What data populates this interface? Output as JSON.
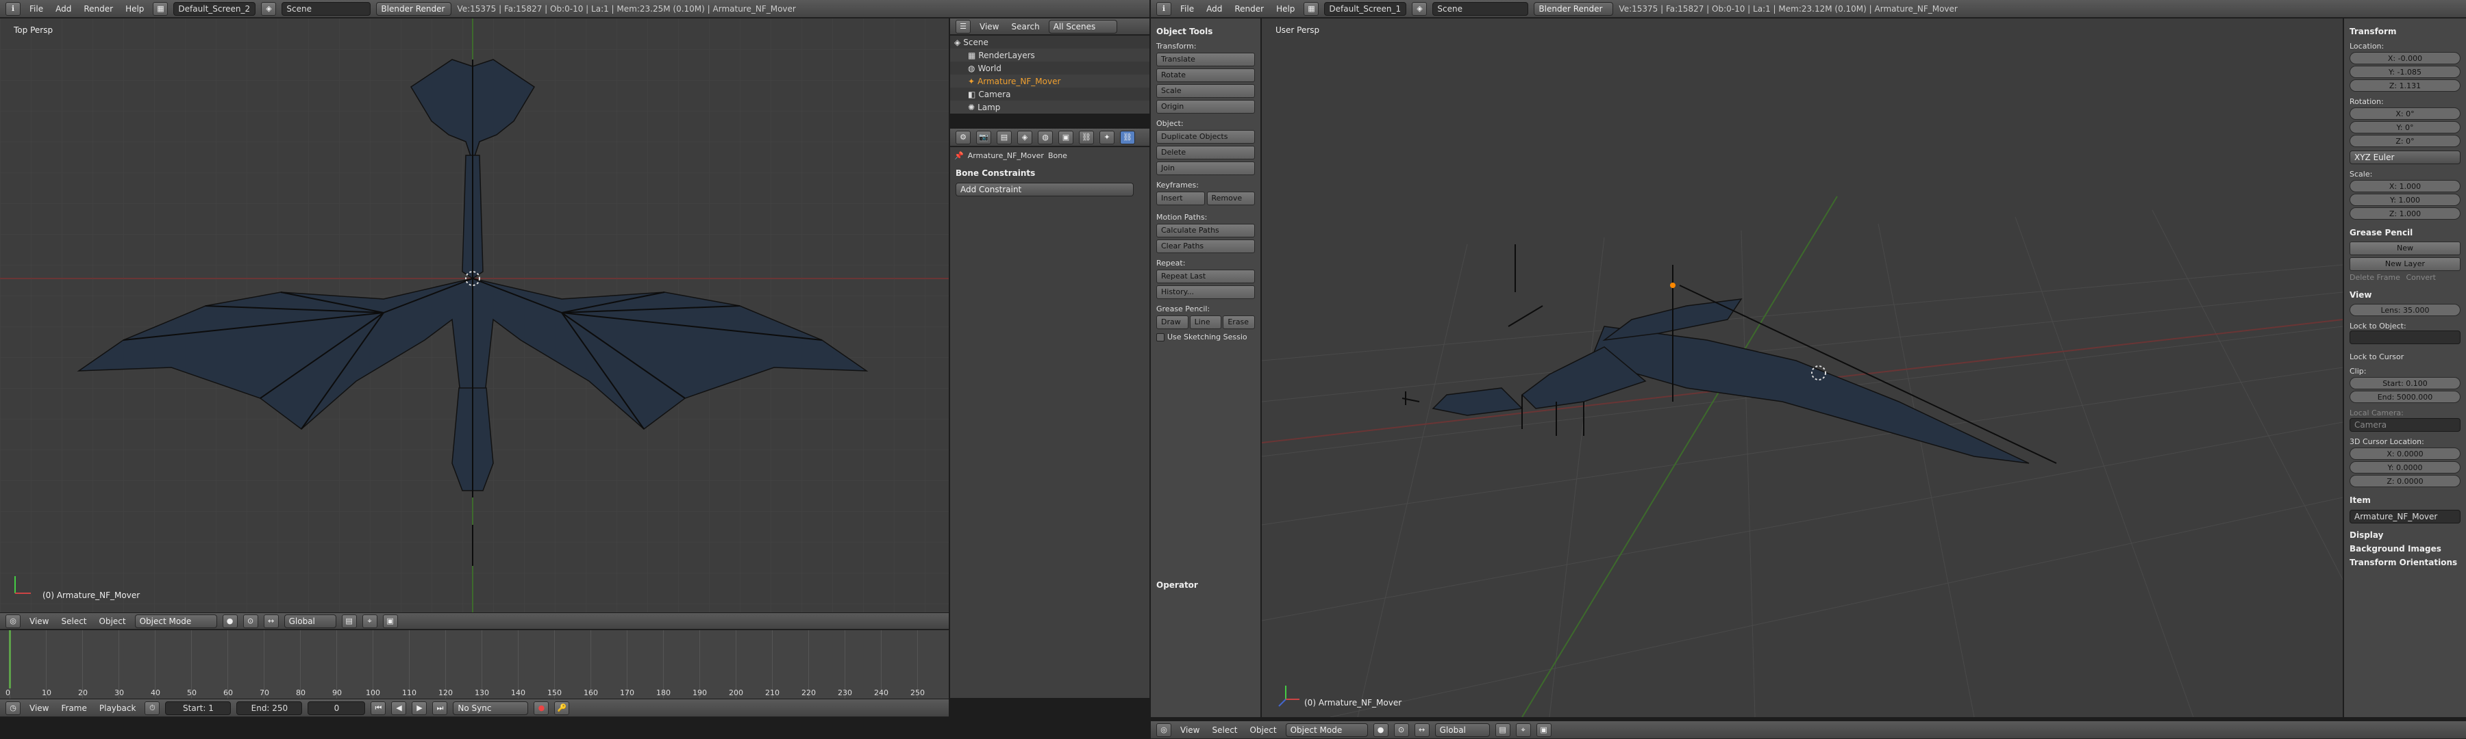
{
  "left": {
    "header": {
      "menus": [
        "File",
        "Add",
        "Render",
        "Help"
      ],
      "screen": "Default_Screen_2",
      "scene": "Scene",
      "engine": "Blender Render",
      "stats": "Ve:15375 | Fa:15827 | Ob:0-10 | La:1 | Mem:23.25M (0.10M) | Armature_NF_Mover"
    },
    "viewport": {
      "name": "Top Persp",
      "object": "(0) Armature_NF_Mover",
      "menus": [
        "View",
        "Select",
        "Object"
      ],
      "mode": "Object Mode",
      "orient": "Global"
    },
    "timeline": {
      "ticks": [
        "0",
        "10",
        "20",
        "30",
        "40",
        "50",
        "60",
        "70",
        "80",
        "90",
        "100",
        "110",
        "120",
        "130",
        "140",
        "150",
        "160",
        "170",
        "180",
        "190",
        "200",
        "210",
        "220",
        "230",
        "240",
        "250"
      ],
      "menus": [
        "View",
        "Frame",
        "Playback"
      ],
      "start": "Start: 1",
      "end": "End: 250",
      "current": "0",
      "sync": "No Sync"
    },
    "outliner": {
      "menus": [
        "View",
        "Search"
      ],
      "scenes": "All Scenes",
      "items": [
        "Scene",
        "RenderLayers",
        "World",
        "Armature_NF_Mover",
        "Camera",
        "Lamp"
      ]
    },
    "properties": {
      "breadcrumb_obj": "Armature_NF_Mover",
      "breadcrumb_bone": "Bone",
      "panel": "Bone Constraints",
      "add": "Add Constraint"
    }
  },
  "right": {
    "header": {
      "menus": [
        "File",
        "Add",
        "Render",
        "Help"
      ],
      "screen": "Default_Screen_1",
      "scene": "Scene",
      "engine": "Blender Render",
      "stats": "Ve:15375 | Fa:15827 | Ob:0-10 | La:1 | Mem:23.12M (0.10M) | Armature_NF_Mover"
    },
    "tools": {
      "title": "Object Tools",
      "transform_label": "Transform:",
      "translate": "Translate",
      "rotate": "Rotate",
      "scale": "Scale",
      "origin": "Origin",
      "object_label": "Object:",
      "duplicate": "Duplicate Objects",
      "delete": "Delete",
      "join": "Join",
      "keyframes_label": "Keyframes:",
      "insert": "Insert",
      "remove": "Remove",
      "motion_label": "Motion Paths:",
      "calc": "Calculate Paths",
      "clear": "Clear Paths",
      "repeat_label": "Repeat:",
      "repeat_last": "Repeat Last",
      "history": "History...",
      "gp_label": "Grease Pencil:",
      "draw": "Draw",
      "line": "Line",
      "erase": "Erase",
      "sketch": "Use Sketching Sessio",
      "operator": "Operator"
    },
    "viewport": {
      "name": "User Persp",
      "object": "(0) Armature_NF_Mover",
      "menus": [
        "View",
        "Select",
        "Object"
      ],
      "mode": "Object Mode",
      "orient": "Global"
    },
    "n_panel": {
      "transform": "Transform",
      "location": "Location:",
      "loc": [
        "X: -0.000",
        "Y: -1.085",
        "Z: 1.131"
      ],
      "rotation": "Rotation:",
      "rot": [
        "X: 0°",
        "Y: 0°",
        "Z: 0°"
      ],
      "euler": "XYZ Euler",
      "scale": "Scale:",
      "scl": [
        "X: 1.000",
        "Y: 1.000",
        "Z: 1.000"
      ],
      "grease": "Grease Pencil",
      "new": "New",
      "new_layer": "New Layer",
      "delete_frame": "Delete Frame",
      "convert": "Convert",
      "view": "View",
      "lens": "Lens: 35.000",
      "lock_obj": "Lock to Object:",
      "lock_cursor": "Lock to Cursor",
      "clip": "Clip:",
      "clip_start": "Start: 0.100",
      "clip_end": "End: 5000.000",
      "local_cam": "Local Camera:",
      "camera": "Camera",
      "cursor": "3D Cursor Location:",
      "cur": [
        "X: 0.0000",
        "Y: 0.0000",
        "Z: 0.0000"
      ],
      "item": "Item",
      "item_name": "Armature_NF_Mover",
      "display": "Display",
      "bg_images": "Background Images",
      "orientations": "Transform Orientations"
    }
  }
}
